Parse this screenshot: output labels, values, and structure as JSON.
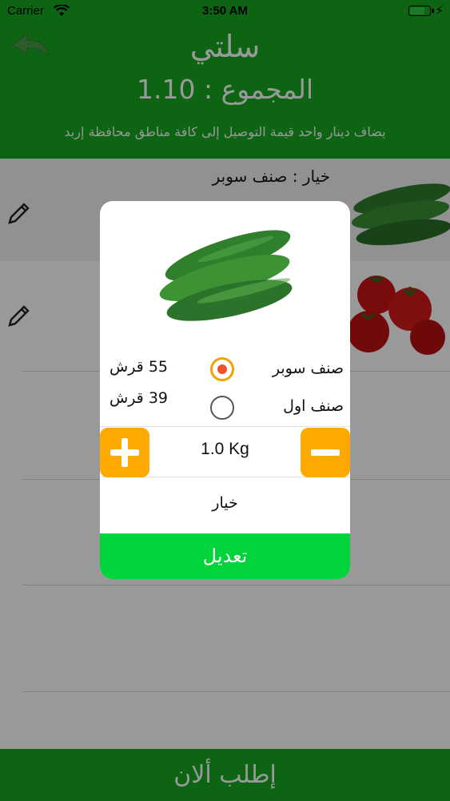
{
  "status_bar": {
    "carrier": "Carrier",
    "time": "3:50 AM"
  },
  "header": {
    "title": "سلتي",
    "total": "المجموع : 1.10",
    "delivery_note": "يضاف دينار واحد قيمة التوصيل إلى كافة مناطق محافظة إربد"
  },
  "cart": {
    "items": [
      {
        "title": "خيار : صنف سوبر",
        "image": "cucumber"
      },
      {
        "title": "",
        "image": "tomato"
      }
    ]
  },
  "dialog": {
    "product_image": "cucumber",
    "options": [
      {
        "name": "صنف سوبر",
        "price": "55 قرش",
        "selected": true
      },
      {
        "name": "صنف اول",
        "price": "39 قرش",
        "selected": false
      }
    ],
    "quantity": "1.0 Kg",
    "product_name": "خيار",
    "edit_label": "تعديل"
  },
  "footer": {
    "order_label": "إطلب ألان"
  },
  "colors": {
    "brand_green": "#17a821",
    "accent_orange": "#ffa800",
    "edit_green": "#00d43a"
  }
}
